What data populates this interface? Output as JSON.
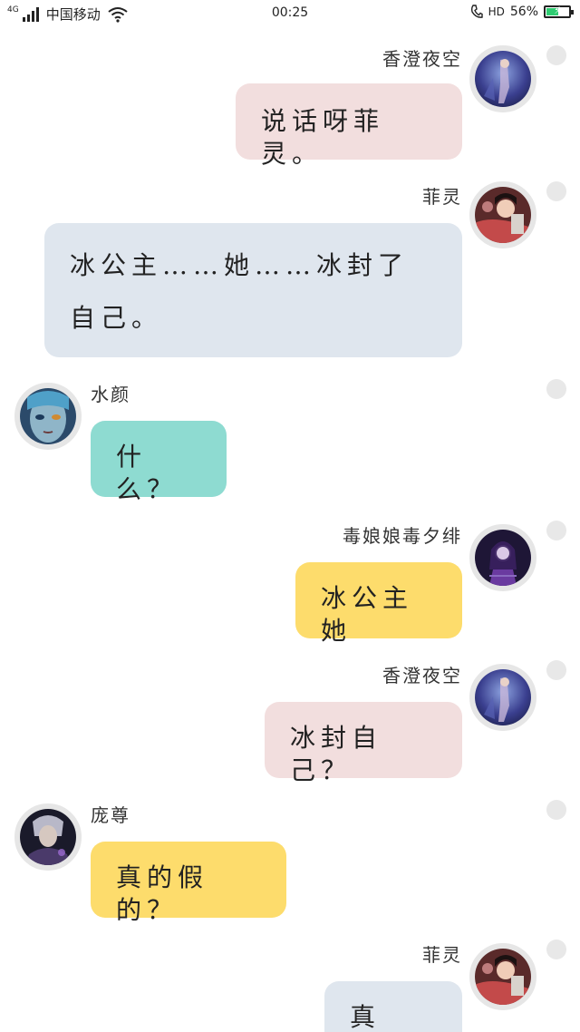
{
  "status_bar": {
    "network": "4G",
    "carrier": "中国移动",
    "time": "00:25",
    "hd": "HD",
    "battery": "56%",
    "battery_level": 0.56,
    "battery_color": "#2ecc71"
  },
  "messages": [
    {
      "name": "香澄夜空",
      "text": "说话呀菲灵。",
      "side": "outgoing",
      "bubble_color": "#f2dede",
      "avatar": "avatar-xiangcheng-yekong"
    },
    {
      "name": "菲灵",
      "text": "冰公主……她……冰封了自己。",
      "side": "outgoing",
      "bubble_color": "#dfe6ee",
      "avatar": "avatar-feiling"
    },
    {
      "name": "水颜",
      "text": "什么？",
      "side": "incoming",
      "bubble_color": "#8edbd1",
      "avatar": "avatar-shuiyan"
    },
    {
      "name": "毒娘娘毒夕绯",
      "text": "冰公主她",
      "side": "outgoing",
      "bubble_color": "#fddc6c",
      "avatar": "avatar-duniangniang"
    },
    {
      "name": "香澄夜空",
      "text": "冰封自己？",
      "side": "outgoing",
      "bubble_color": "#f2dede",
      "avatar": "avatar-xiangcheng-yekong"
    },
    {
      "name": "庞尊",
      "text": "真的假的？",
      "side": "incoming",
      "bubble_color": "#fddc6c",
      "avatar": "avatar-pangzun"
    },
    {
      "name": "菲灵",
      "text": "真的。",
      "side": "outgoing",
      "bubble_color": "#dfe6ee",
      "avatar": "avatar-feiling"
    }
  ]
}
